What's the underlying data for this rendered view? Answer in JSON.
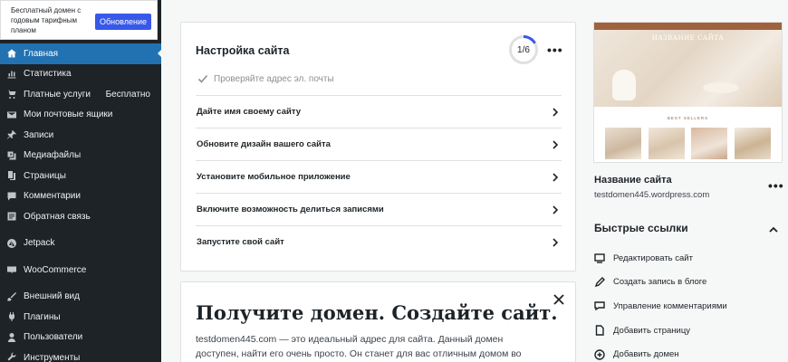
{
  "promo": {
    "text": "Бесплатный домен с годовым тарифным планом",
    "button": "Обновление"
  },
  "sidebar": {
    "items": [
      {
        "label": "Главная",
        "icon": "home-icon",
        "active": true
      },
      {
        "label": "Статистика",
        "icon": "stats-icon"
      },
      {
        "label": "Платные услуги",
        "icon": "cart-icon",
        "badge": "Бесплатно"
      },
      {
        "label": "Мои почтовые ящики",
        "icon": "mail-icon"
      },
      {
        "label": "Записи",
        "icon": "pin-icon"
      },
      {
        "label": "Медиафайлы",
        "icon": "media-icon"
      },
      {
        "label": "Страницы",
        "icon": "pages-icon"
      },
      {
        "label": "Комментарии",
        "icon": "comment-icon"
      },
      {
        "label": "Обратная связь",
        "icon": "feedback-icon"
      },
      {
        "label": "Jetpack",
        "icon": "jetpack-icon"
      },
      {
        "label": "WooCommerce",
        "icon": "woo-icon"
      },
      {
        "label": "Внешний вид",
        "icon": "brush-icon"
      },
      {
        "label": "Плагины",
        "icon": "plugin-icon"
      },
      {
        "label": "Пользователи",
        "icon": "user-icon"
      },
      {
        "label": "Инструменты",
        "icon": "wrench-icon"
      }
    ]
  },
  "setup": {
    "title": "Настройка сайта",
    "progress_label": "1/6",
    "progress_fraction": 0.1667,
    "completed_task": "Проверяйте адрес эл. почты",
    "tasks": [
      "Дайте имя своему сайту",
      "Обновите дизайн вашего сайта",
      "Установите мобильное приложение",
      "Включите возможность делиться записями",
      "Запустите свой сайт"
    ]
  },
  "domain": {
    "title": "Получите домен. Создайте сайт.",
    "domain_name": "testdomen445.com",
    "description_rest": " — это идеальный адрес для сайта. Данный домен доступен, найти его очень просто. Он станет для вас отличным домом во"
  },
  "site": {
    "preview_title": "НАЗВАНИЕ САЙТА",
    "name": "Название сайта",
    "url": "testdomen445.wordpress.com"
  },
  "quick_links": {
    "title": "Быстрые ссылки",
    "items": [
      {
        "label": "Редактировать сайт",
        "icon": "monitor-icon"
      },
      {
        "label": "Создать запись в блоге",
        "icon": "pencil-icon"
      },
      {
        "label": "Управление комментариями",
        "icon": "comment-icon"
      },
      {
        "label": "Добавить страницу",
        "icon": "page-icon"
      },
      {
        "label": "Добавить домен",
        "icon": "plus-circle-icon"
      }
    ]
  },
  "colors": {
    "sidebar_bg": "#1d2327",
    "active": "#2271b1",
    "button": "#3858e9",
    "progress": "#3858e9"
  }
}
